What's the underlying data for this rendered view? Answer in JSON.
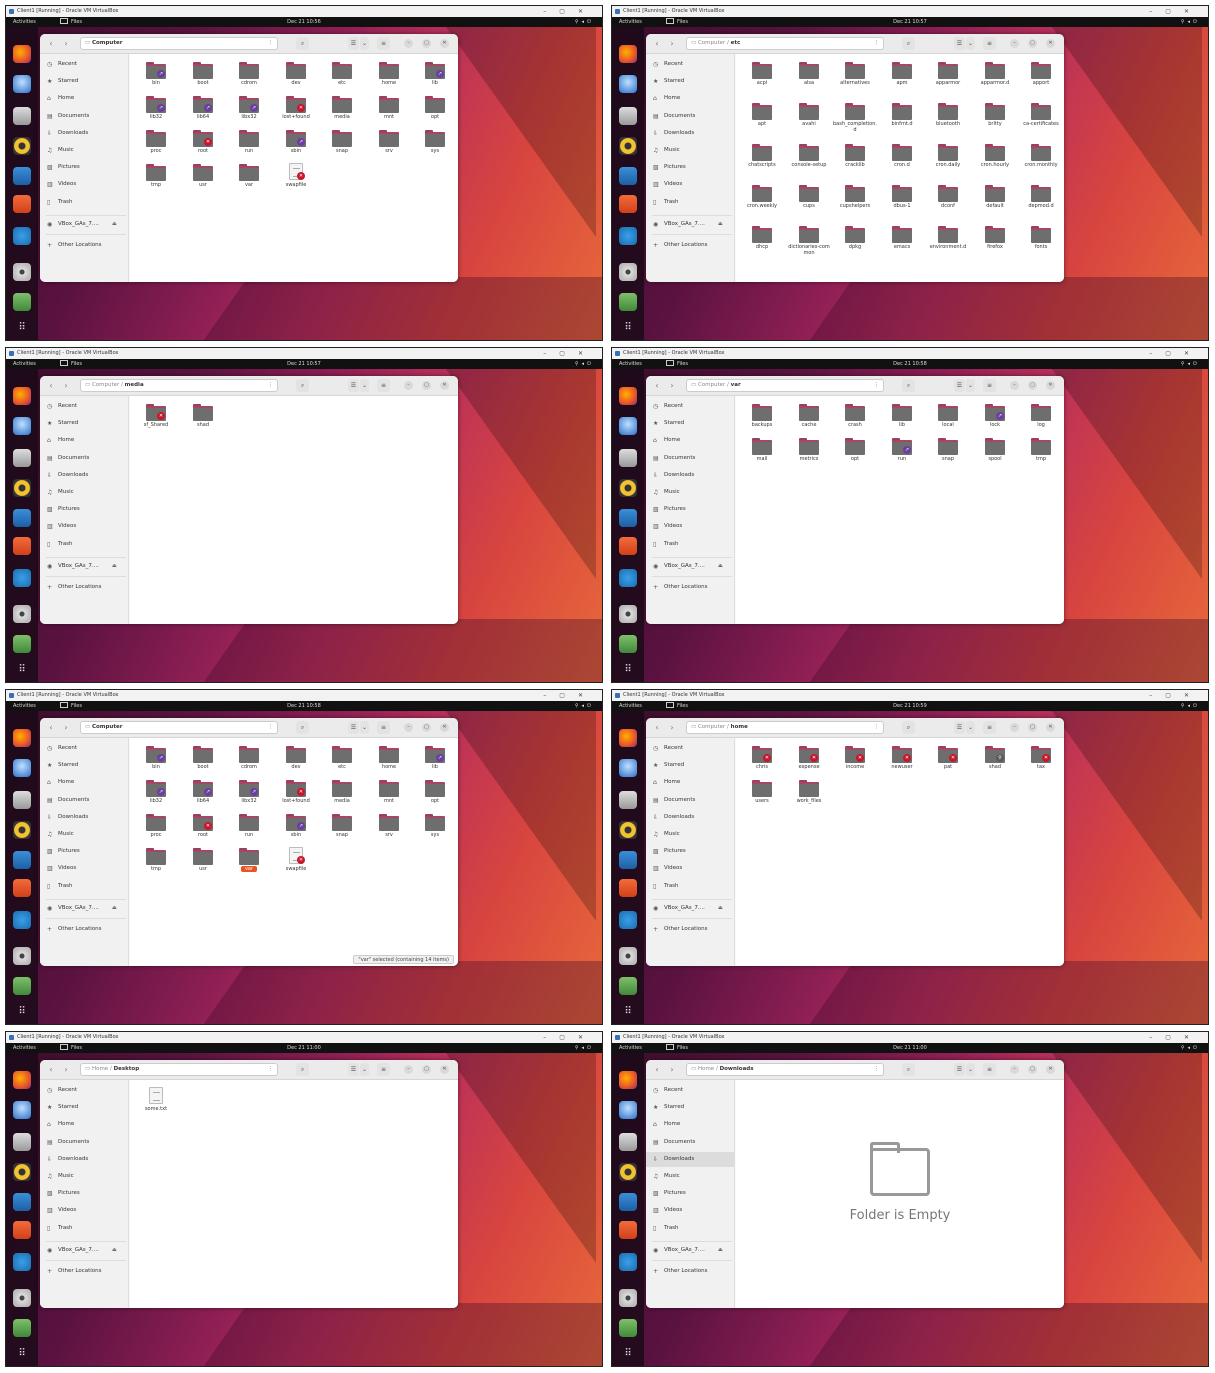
{
  "vm_title": "Client1 [Running] - Oracle VM VirtualBox",
  "activities": "Activities",
  "app_name": "Files",
  "sidebar_items": [
    {
      "icon": "clock-icon",
      "glyph": "◷",
      "label": "Recent"
    },
    {
      "icon": "star-icon",
      "glyph": "★",
      "label": "Starred"
    },
    {
      "icon": "home-icon",
      "glyph": "⌂",
      "label": "Home"
    },
    {
      "icon": "document-icon",
      "glyph": "▤",
      "label": "Documents"
    },
    {
      "icon": "download-icon",
      "glyph": "⇩",
      "label": "Downloads"
    },
    {
      "icon": "music-icon",
      "glyph": "♫",
      "label": "Music"
    },
    {
      "icon": "picture-icon",
      "glyph": "▧",
      "label": "Pictures"
    },
    {
      "icon": "video-icon",
      "glyph": "▥",
      "label": "Videos"
    },
    {
      "icon": "trash-icon",
      "glyph": "▯",
      "label": "Trash"
    }
  ],
  "sidebar_drive": "VBox_GAs_7....",
  "sidebar_other": "Other Locations",
  "panels": [
    {
      "clock": "Dec 21 10:56",
      "path": [
        {
          "text": "Computer",
          "strong": true
        }
      ],
      "items": [
        {
          "name": "bin",
          "badge": "link"
        },
        {
          "name": "boot"
        },
        {
          "name": "cdrom"
        },
        {
          "name": "dev"
        },
        {
          "name": "etc"
        },
        {
          "name": "home"
        },
        {
          "name": "lib",
          "badge": "link"
        },
        {
          "name": "lib32",
          "badge": "link"
        },
        {
          "name": "lib64",
          "badge": "link"
        },
        {
          "name": "libx32",
          "badge": "link"
        },
        {
          "name": "lost+found",
          "badge": "lock"
        },
        {
          "name": "media"
        },
        {
          "name": "mnt"
        },
        {
          "name": "opt"
        },
        {
          "name": "proc"
        },
        {
          "name": "root",
          "badge": "lock"
        },
        {
          "name": "run"
        },
        {
          "name": "sbin",
          "badge": "link"
        },
        {
          "name": "snap"
        },
        {
          "name": "srv"
        },
        {
          "name": "sys"
        },
        {
          "name": "tmp"
        },
        {
          "name": "usr"
        },
        {
          "name": "var"
        },
        {
          "name": "swapfile",
          "type": "file",
          "badge": "lock"
        }
      ]
    },
    {
      "clock": "Dec 21 10:57",
      "path": [
        {
          "text": "Computer",
          "strong": false
        },
        {
          "text": "etc",
          "strong": true
        }
      ],
      "items": [
        {
          "name": "acpi"
        },
        {
          "name": "alsa"
        },
        {
          "name": "alternatives"
        },
        {
          "name": "apm"
        },
        {
          "name": "apparmor"
        },
        {
          "name": "apparmor.d"
        },
        {
          "name": "apport"
        },
        {
          "name": "apt"
        },
        {
          "name": "avahi"
        },
        {
          "name": "bash_completion.d"
        },
        {
          "name": "binfmt.d"
        },
        {
          "name": "bluetooth"
        },
        {
          "name": "brltty"
        },
        {
          "name": "ca-certificates"
        },
        {
          "name": "chatscripts"
        },
        {
          "name": "console-setup"
        },
        {
          "name": "cracklib"
        },
        {
          "name": "cron.d"
        },
        {
          "name": "cron.daily"
        },
        {
          "name": "cron.hourly"
        },
        {
          "name": "cron.monthly"
        },
        {
          "name": "cron.weekly"
        },
        {
          "name": "cups"
        },
        {
          "name": "cupshelpers"
        },
        {
          "name": "dbus-1"
        },
        {
          "name": "dconf"
        },
        {
          "name": "default"
        },
        {
          "name": "depmod.d"
        },
        {
          "name": "dhcp"
        },
        {
          "name": "dictionaries-common"
        },
        {
          "name": "dpkg"
        },
        {
          "name": "emacs"
        },
        {
          "name": "environment.d"
        },
        {
          "name": "firefox"
        },
        {
          "name": "fonts"
        }
      ]
    },
    {
      "clock": "Dec 21 10:57",
      "path": [
        {
          "text": "Computer",
          "strong": false
        },
        {
          "text": "media",
          "strong": true
        }
      ],
      "items": [
        {
          "name": "sf_Shared",
          "badge": "lock"
        },
        {
          "name": "shad"
        }
      ]
    },
    {
      "clock": "Dec 21 10:58",
      "path": [
        {
          "text": "Computer",
          "strong": false
        },
        {
          "text": "var",
          "strong": true
        }
      ],
      "items": [
        {
          "name": "backups"
        },
        {
          "name": "cache"
        },
        {
          "name": "crash"
        },
        {
          "name": "lib"
        },
        {
          "name": "local"
        },
        {
          "name": "lock",
          "badge": "link"
        },
        {
          "name": "log"
        },
        {
          "name": "mail"
        },
        {
          "name": "metrics"
        },
        {
          "name": "opt"
        },
        {
          "name": "run",
          "badge": "link"
        },
        {
          "name": "snap"
        },
        {
          "name": "spool"
        },
        {
          "name": "tmp"
        }
      ]
    },
    {
      "clock": "Dec 21 10:58",
      "path": [
        {
          "text": "Computer",
          "strong": true
        }
      ],
      "status": "\"var\" selected  (containing 14 items)",
      "items": [
        {
          "name": "bin",
          "badge": "link"
        },
        {
          "name": "boot"
        },
        {
          "name": "cdrom"
        },
        {
          "name": "dev"
        },
        {
          "name": "etc"
        },
        {
          "name": "home"
        },
        {
          "name": "lib",
          "badge": "link"
        },
        {
          "name": "lib32",
          "badge": "link"
        },
        {
          "name": "lib64",
          "badge": "link"
        },
        {
          "name": "libx32",
          "badge": "link"
        },
        {
          "name": "lost+found",
          "badge": "lock"
        },
        {
          "name": "media"
        },
        {
          "name": "mnt"
        },
        {
          "name": "opt"
        },
        {
          "name": "proc"
        },
        {
          "name": "root",
          "badge": "lock"
        },
        {
          "name": "run"
        },
        {
          "name": "sbin",
          "badge": "link"
        },
        {
          "name": "snap"
        },
        {
          "name": "srv"
        },
        {
          "name": "sys"
        },
        {
          "name": "tmp"
        },
        {
          "name": "usr"
        },
        {
          "name": "var",
          "selected": true
        },
        {
          "name": "swapfile",
          "type": "file",
          "badge": "lock"
        }
      ]
    },
    {
      "clock": "Dec 21 10:59",
      "path": [
        {
          "text": "Computer",
          "strong": false
        },
        {
          "text": "home",
          "strong": true
        }
      ],
      "items": [
        {
          "name": "chris",
          "badge": "lock"
        },
        {
          "name": "expense",
          "badge": "lock"
        },
        {
          "name": "income",
          "badge": "lock"
        },
        {
          "name": "newuser",
          "badge": "lock"
        },
        {
          "name": "pat",
          "badge": "lock"
        },
        {
          "name": "shad",
          "badge": "share"
        },
        {
          "name": "tax",
          "badge": "lock"
        },
        {
          "name": "users"
        },
        {
          "name": "work_files"
        }
      ]
    },
    {
      "clock": "Dec 21 11:00",
      "path": [
        {
          "text": "Home",
          "strong": false
        },
        {
          "text": "Desktop",
          "strong": true
        }
      ],
      "items": [
        {
          "name": "some.txt",
          "type": "file"
        }
      ]
    },
    {
      "clock": "Dec 21 11:00",
      "path": [
        {
          "text": "Home",
          "strong": false
        },
        {
          "text": "Downloads",
          "strong": true
        }
      ],
      "active_sidebar": "Downloads",
      "empty_text": "Folder is Empty",
      "items": []
    }
  ],
  "colors": {
    "accent": "#e95420",
    "folder_tab": "#a74564",
    "folder_body": "#6e6e6e",
    "link_badge": "#6b3fa0",
    "lock_badge": "#c7162b"
  }
}
